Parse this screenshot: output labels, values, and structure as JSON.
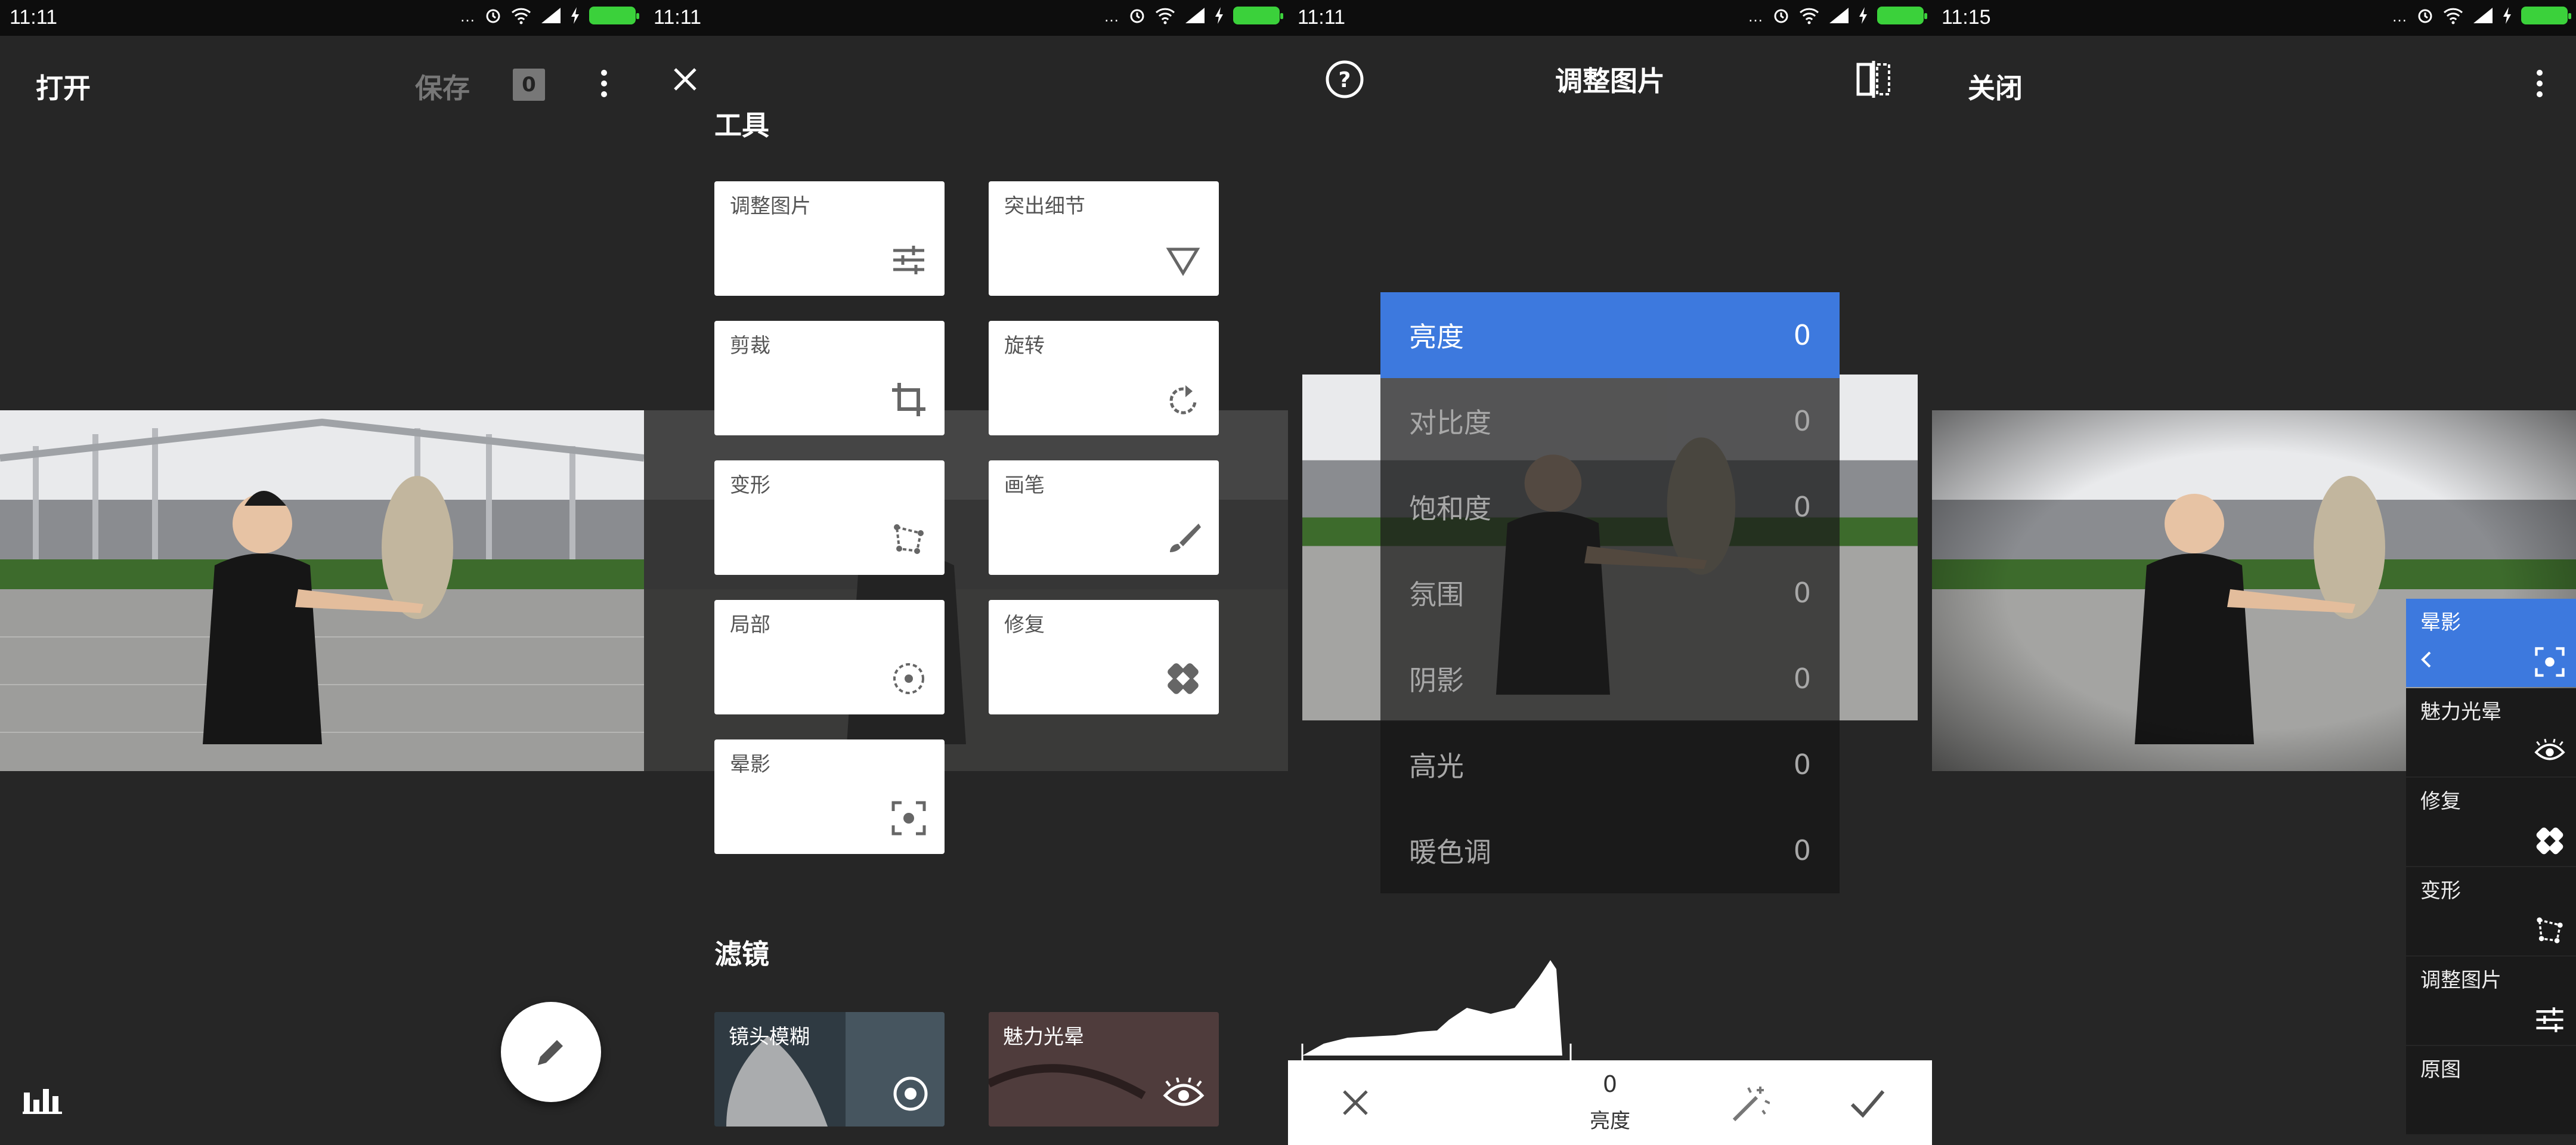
{
  "status_time": [
    "11:11",
    "11:11",
    "11:11",
    "11:15"
  ],
  "status_icons": "…",
  "screen1": {
    "open_label": "打开",
    "save_label": "保存",
    "save_count": "0"
  },
  "screen2": {
    "tools_title": "工具",
    "tools": [
      "调整图片",
      "突出细节",
      "剪裁",
      "旋转",
      "变形",
      "画笔",
      "局部",
      "修复",
      "晕影"
    ],
    "filters_title": "滤镜",
    "filters": [
      "镜头模糊",
      "魅力光晕"
    ]
  },
  "screen3": {
    "title": "调整图片",
    "rows": [
      {
        "label": "亮度",
        "value": "0"
      },
      {
        "label": "对比度",
        "value": "0"
      },
      {
        "label": "饱和度",
        "value": "0"
      },
      {
        "label": "氛围",
        "value": "0"
      },
      {
        "label": "阴影",
        "value": "0"
      },
      {
        "label": "高光",
        "value": "0"
      },
      {
        "label": "暖色调",
        "value": "0"
      }
    ],
    "bottom_value": "0",
    "bottom_label": "亮度"
  },
  "screen4": {
    "close_label": "关闭",
    "history": [
      "晕影",
      "魅力光晕",
      "修复",
      "变形",
      "调整图片",
      "原图"
    ]
  },
  "colors": {
    "accent": "#3d79de",
    "bg": "#262626",
    "panel": "#1a1a1a"
  }
}
